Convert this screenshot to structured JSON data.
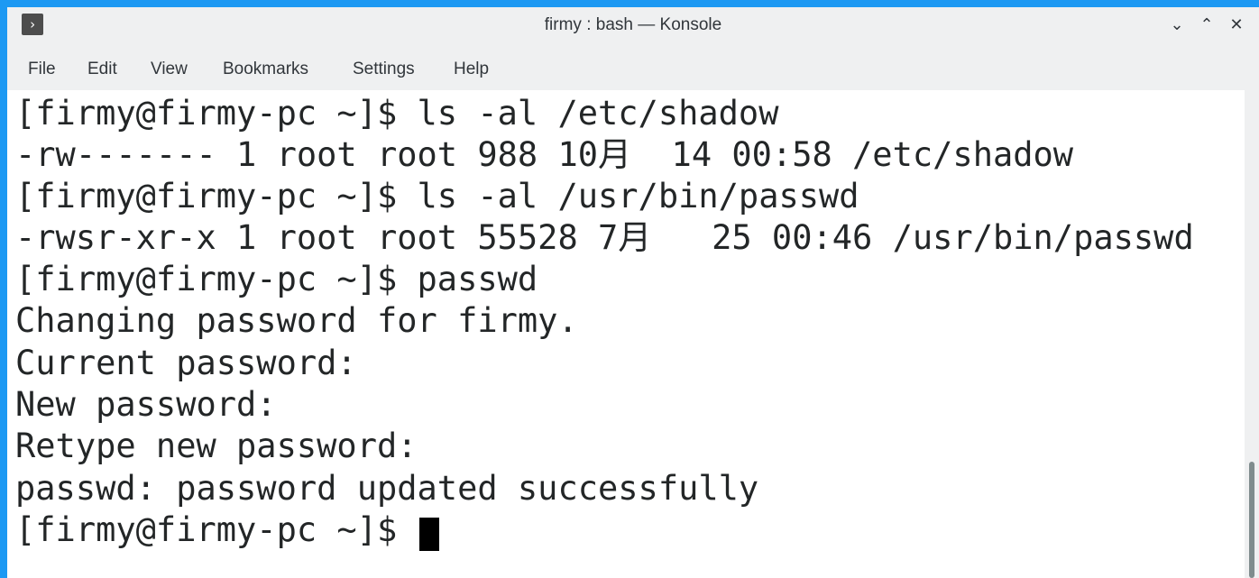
{
  "window": {
    "title": "firmy : bash — Konsole",
    "app_icon": "terminal-icon",
    "controls": {
      "minimize": "chevron-down-icon",
      "maximize": "chevron-up-icon",
      "close": "close-icon"
    },
    "accent_color": "#1d99f3"
  },
  "menu": {
    "file": "File",
    "edit": "Edit",
    "view": "View",
    "bookmarks": "Bookmarks",
    "settings": "Settings",
    "help": "Help"
  },
  "terminal": {
    "lines": [
      "[firmy@firmy-pc ~]$ ls -al /etc/shadow",
      "-rw------- 1 root root 988 10月  14 00:58 /etc/shadow",
      "[firmy@firmy-pc ~]$ ls -al /usr/bin/passwd",
      "-rwsr-xr-x 1 root root 55528 7月   25 00:46 /usr/bin/passwd",
      "[firmy@firmy-pc ~]$ passwd",
      "Changing password for firmy.",
      "Current password:",
      "New password:",
      "Retype new password:",
      "passwd: password updated successfully",
      "[firmy@firmy-pc ~]$ "
    ],
    "background": "#ffffff",
    "foreground": "#232627"
  }
}
